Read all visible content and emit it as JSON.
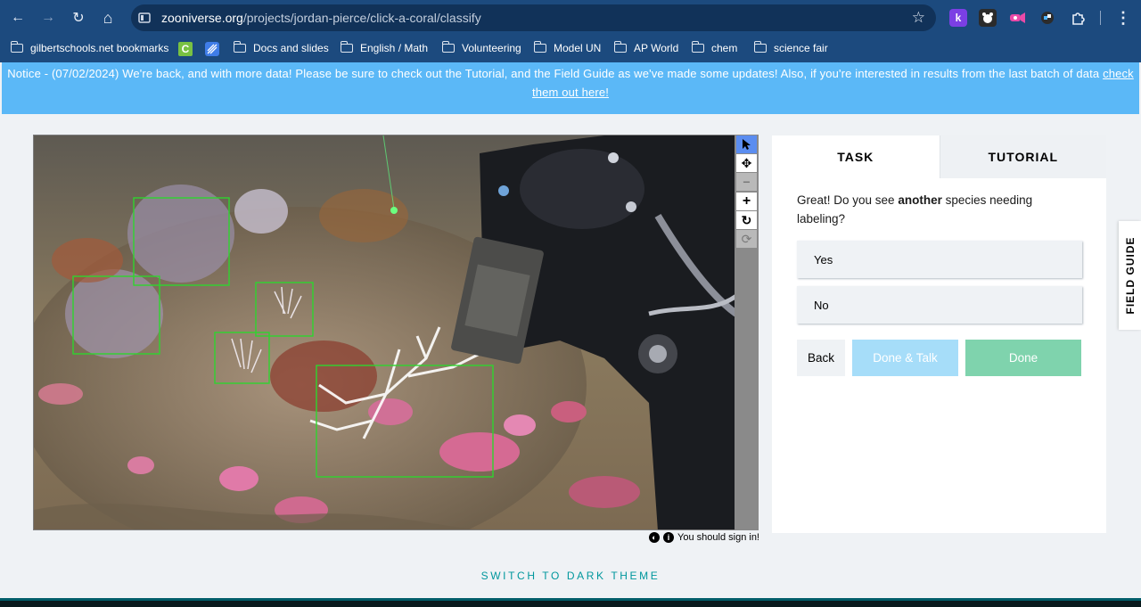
{
  "browser": {
    "url_host": "zooniverse.org",
    "url_path": "/projects/jordan-pierce/click-a-coral/classify",
    "nav": {
      "back": "←",
      "forward": "→",
      "reload": "↻",
      "home": "⌂"
    },
    "icons": [
      "site-info-icon",
      "star-icon",
      "extensions-icon",
      "menu-icon"
    ]
  },
  "bookmarks": [
    {
      "label": "gilbertschools.net bookmarks",
      "icon": "folder-icon"
    },
    {
      "label": "",
      "icon": "c-extension-icon"
    },
    {
      "label": "",
      "icon": "striped-extension-icon"
    },
    {
      "label": "Docs and slides",
      "icon": "folder-icon"
    },
    {
      "label": "English / Math",
      "icon": "folder-icon"
    },
    {
      "label": "Volunteering",
      "icon": "folder-icon"
    },
    {
      "label": "Model UN",
      "icon": "folder-icon"
    },
    {
      "label": "AP World",
      "icon": "folder-icon"
    },
    {
      "label": "chem",
      "icon": "folder-icon"
    },
    {
      "label": "science fair",
      "icon": "folder-icon"
    }
  ],
  "notice": {
    "text": "Notice - (07/02/2024) We're back, and with more data! Please be sure to check out the Tutorial, and the Field Guide as we've made some updates! Also, if you're interested in results from the last batch of data",
    "link": "check them out here!"
  },
  "viewer": {
    "tools": [
      "pointer-icon",
      "move-icon",
      "zoom-out-icon",
      "zoom-in-icon",
      "rotate-icon",
      "reset-icon"
    ],
    "sign_in_note": "You should sign in!"
  },
  "task_panel": {
    "tabs": [
      "TASK",
      "TUTORIAL"
    ],
    "question_prefix": "Great! Do you see",
    "question_bold": "another",
    "question_suffix": "species needing labeling?",
    "answers": [
      "Yes",
      "No"
    ],
    "buttons": {
      "back": "Back",
      "done_talk": "Done & Talk",
      "done": "Done"
    }
  },
  "field_guide": "FIELD GUIDE",
  "theme_switch": "SWITCH TO DARK THEME",
  "colors": {
    "chrome": "#1c4a7e",
    "notice": "#5bb8f7",
    "done": "#7fd3ad",
    "done_talk": "#a6ddf9",
    "theme_link": "#00979d"
  }
}
